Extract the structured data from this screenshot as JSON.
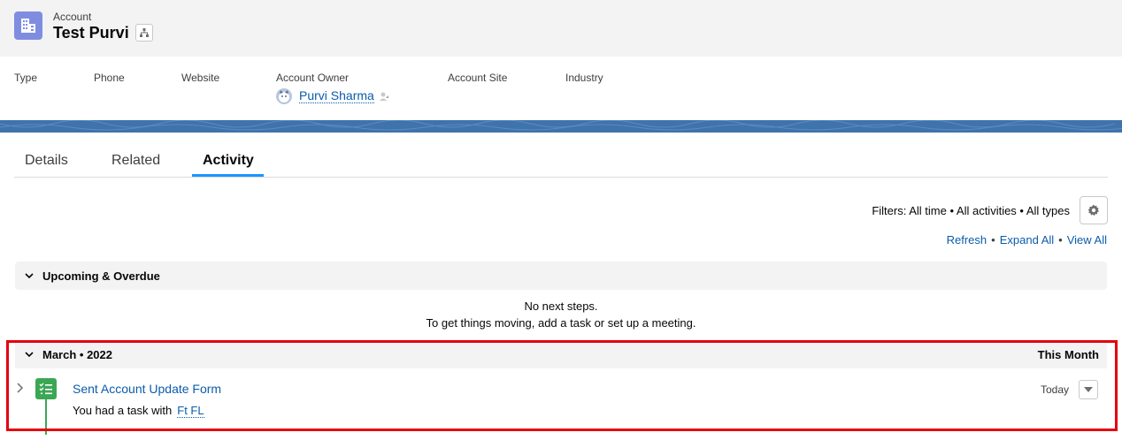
{
  "header": {
    "object_label": "Account",
    "record_title": "Test Purvi"
  },
  "fields": {
    "type_label": "Type",
    "phone_label": "Phone",
    "website_label": "Website",
    "owner_label": "Account Owner",
    "owner_name": "Purvi Sharma",
    "site_label": "Account Site",
    "industry_label": "Industry"
  },
  "tabs": [
    {
      "label": "Details"
    },
    {
      "label": "Related"
    },
    {
      "label": "Activity"
    }
  ],
  "activity": {
    "filters": "Filters: All time • All activities • All types",
    "refresh": "Refresh",
    "expand_all": "Expand All",
    "view_all": "View All",
    "link_separator": "•",
    "upcoming": {
      "title": "Upcoming & Overdue",
      "empty_line1": "No next steps.",
      "empty_line2": "To get things moving, add a task or set up a meeting."
    },
    "month_section": {
      "title": "March • 2022",
      "right_label": "This Month"
    },
    "item": {
      "title": "Sent Account Update Form",
      "desc_prefix": "You had a task with",
      "desc_who": "Ft FL",
      "date": "Today"
    }
  },
  "colors": {
    "account_icon": "#7f8de1",
    "link": "#0b5cab",
    "task_icon": "#3ba755",
    "highlight": "#e4000f",
    "banner": "#3f73ab"
  },
  "icons": {
    "account": "building-icon",
    "hierarchy": "hierarchy-icon",
    "gear": "gear-icon",
    "task": "task-icon",
    "chevron": "chevron-icon"
  }
}
